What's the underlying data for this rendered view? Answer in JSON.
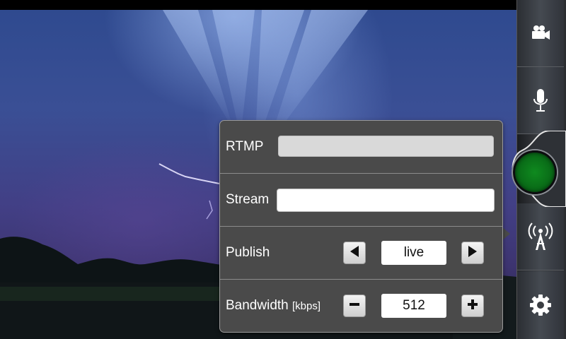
{
  "rail": {
    "video_icon": "video-camera-icon",
    "mic_icon": "microphone-icon",
    "record_icon": "record-button",
    "broadcast_icon": "broadcast-antenna-icon",
    "settings_icon": "gear-icon",
    "record_color": "#0a6e18"
  },
  "settings": {
    "rtmp_label": "RTMP",
    "rtmp_value": "",
    "stream_label": "Stream",
    "stream_value": "",
    "publish_label": "Publish",
    "publish_value": "live",
    "bandwidth_label": "Bandwidth",
    "bandwidth_unit": "[kbps]",
    "bandwidth_value": "512"
  }
}
